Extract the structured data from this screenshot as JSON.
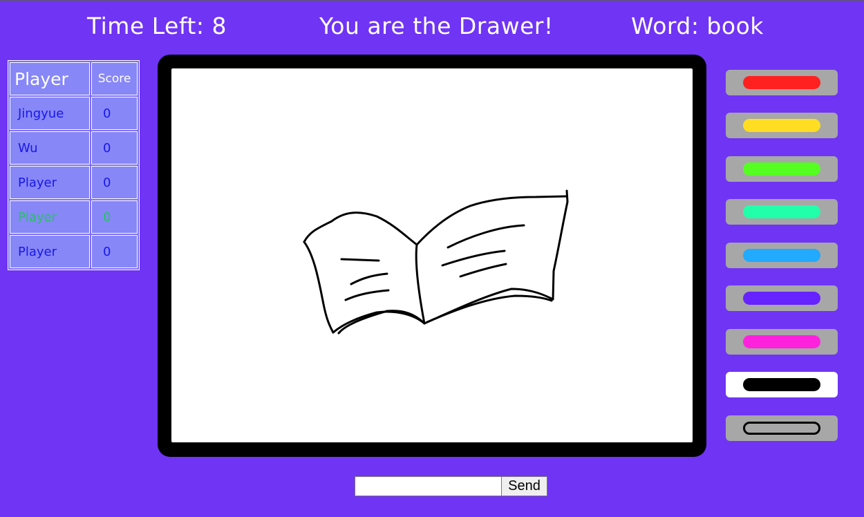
{
  "header": {
    "time_left": "Time Left: 8",
    "role": "You are the Drawer!",
    "word": "Word: book"
  },
  "scoreboard": {
    "headers": {
      "player": "Player",
      "score": "Score"
    },
    "rows": [
      {
        "name": "Jingyue",
        "score": "0"
      },
      {
        "name": "Wu",
        "score": "0"
      },
      {
        "name": "Player",
        "score": "0"
      },
      {
        "name": "Player",
        "score": "0",
        "highlight": "#22c55e"
      },
      {
        "name": "Player",
        "score": "0"
      }
    ]
  },
  "palette": {
    "colors": [
      "#ff2020",
      "#ffdd22",
      "#55ff22",
      "#22ffaa",
      "#22aaff",
      "#6622ff",
      "#ff22dd",
      "#000000"
    ],
    "selected": "#000000",
    "eraser": "eraser"
  },
  "drawing": {
    "subject": "open book sketch",
    "stroke_color": "#000000"
  },
  "chat": {
    "placeholder": "",
    "value": "",
    "send_label": "Send"
  }
}
